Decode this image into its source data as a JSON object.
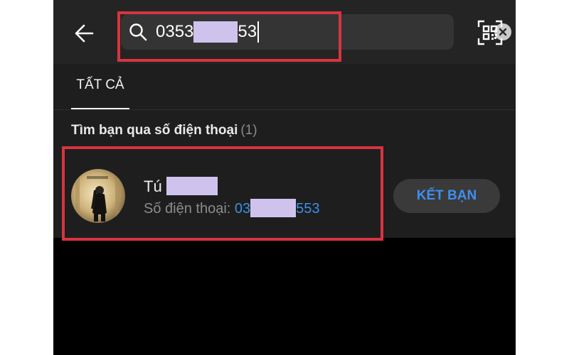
{
  "search": {
    "query_prefix": "0353",
    "query_suffix": "53"
  },
  "tabs": [
    {
      "label": "TẤT CẢ"
    }
  ],
  "section": {
    "title": "Tìm bạn qua số điện thoại",
    "count": "(1)"
  },
  "result": {
    "name": "Tú",
    "phone_label": "Số điện thoại:",
    "phone_prefix": "03",
    "phone_suffix": "553",
    "action_label": "KẾT BẠN"
  },
  "colors": {
    "accent_blue": "#3f8ff0",
    "highlight_red": "#d8343f",
    "redaction": "#cfc3ee"
  }
}
